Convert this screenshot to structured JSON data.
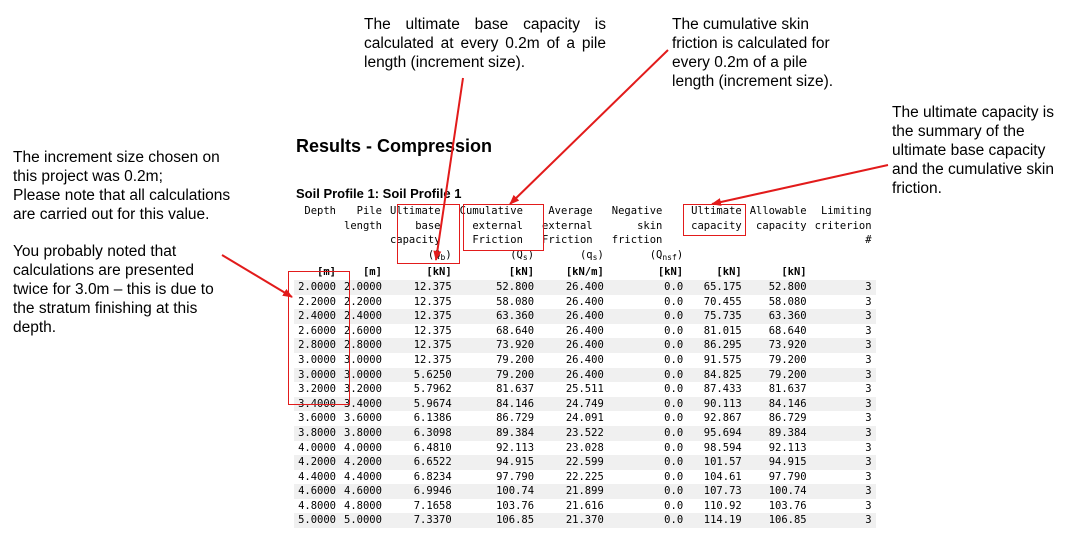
{
  "notes": {
    "base_capacity": "The ultimate base capacity is calculated at every 0.2m of a pile length (increment size).",
    "skin_friction": "The cumulative skin\nfriction is calculated for\nevery 0.2m of a pile\nlength (increment size).",
    "ultimate_capacity": "The ultimate capacity is\nthe summary of the\nultimate base capacity\nand the cumulative skin\nfriction.",
    "increment_size": "The increment size chosen on\nthis project was 0.2m;\nPlease note that all calculations\nare carried out for this value.",
    "twice_3m": "You probably noted that\ncalculations are presented\ntwice for 3.0m – this is due to\nthe stratum finishing at this\ndepth."
  },
  "results_title": "Results - Compression",
  "profile_title": "Soil Profile 1: Soil Profile 1",
  "table": {
    "headers": [
      "Depth",
      "Pile\nlength",
      "Ultimate\nbase\ncapacity\n(Q",
      "Cumulative\nexternal\nFriction\n(Q",
      "Average\nexternal\nFriction\n(q",
      "Negative\nskin\nfriction\n(Q",
      "Ultimate\ncapacity",
      "Allowable\ncapacity",
      "Limiting\ncriterion\n#"
    ],
    "header_subscripts": [
      "",
      "",
      "b",
      "s",
      "s",
      "nsf",
      "",
      "",
      ""
    ],
    "header_suffix": ")",
    "units": [
      "[m]",
      "[m]",
      "[kN]",
      "[kN]",
      "[kN/m]",
      "[kN]",
      "[kN]",
      "[kN]",
      ""
    ],
    "rows": [
      [
        "2.0000",
        "2.0000",
        "12.375",
        "52.800",
        "26.400",
        "0.0",
        "65.175",
        "52.800",
        "3"
      ],
      [
        "2.2000",
        "2.2000",
        "12.375",
        "58.080",
        "26.400",
        "0.0",
        "70.455",
        "58.080",
        "3"
      ],
      [
        "2.4000",
        "2.4000",
        "12.375",
        "63.360",
        "26.400",
        "0.0",
        "75.735",
        "63.360",
        "3"
      ],
      [
        "2.6000",
        "2.6000",
        "12.375",
        "68.640",
        "26.400",
        "0.0",
        "81.015",
        "68.640",
        "3"
      ],
      [
        "2.8000",
        "2.8000",
        "12.375",
        "73.920",
        "26.400",
        "0.0",
        "86.295",
        "73.920",
        "3"
      ],
      [
        "3.0000",
        "3.0000",
        "12.375",
        "79.200",
        "26.400",
        "0.0",
        "91.575",
        "79.200",
        "3"
      ],
      [
        "3.0000",
        "3.0000",
        "5.6250",
        "79.200",
        "26.400",
        "0.0",
        "84.825",
        "79.200",
        "3"
      ],
      [
        "3.2000",
        "3.2000",
        "5.7962",
        "81.637",
        "25.511",
        "0.0",
        "87.433",
        "81.637",
        "3"
      ],
      [
        "3.4000",
        "3.4000",
        "5.9674",
        "84.146",
        "24.749",
        "0.0",
        "90.113",
        "84.146",
        "3"
      ],
      [
        "3.6000",
        "3.6000",
        "6.1386",
        "86.729",
        "24.091",
        "0.0",
        "92.867",
        "86.729",
        "3"
      ],
      [
        "3.8000",
        "3.8000",
        "6.3098",
        "89.384",
        "23.522",
        "0.0",
        "95.694",
        "89.384",
        "3"
      ],
      [
        "4.0000",
        "4.0000",
        "6.4810",
        "92.113",
        "23.028",
        "0.0",
        "98.594",
        "92.113",
        "3"
      ],
      [
        "4.2000",
        "4.2000",
        "6.6522",
        "94.915",
        "22.599",
        "0.0",
        "101.57",
        "94.915",
        "3"
      ],
      [
        "4.4000",
        "4.4000",
        "6.8234",
        "97.790",
        "22.225",
        "0.0",
        "104.61",
        "97.790",
        "3"
      ],
      [
        "4.6000",
        "4.6000",
        "6.9946",
        "100.74",
        "21.899",
        "0.0",
        "107.73",
        "100.74",
        "3"
      ],
      [
        "4.8000",
        "4.8000",
        "7.1658",
        "103.76",
        "21.616",
        "0.0",
        "110.92",
        "103.76",
        "3"
      ],
      [
        "5.0000",
        "5.0000",
        "7.3370",
        "106.85",
        "21.370",
        "0.0",
        "114.19",
        "106.85",
        "3"
      ]
    ]
  },
  "colors": {
    "annotation": "#e21b1b",
    "row_alt": "#f0f0f0"
  }
}
